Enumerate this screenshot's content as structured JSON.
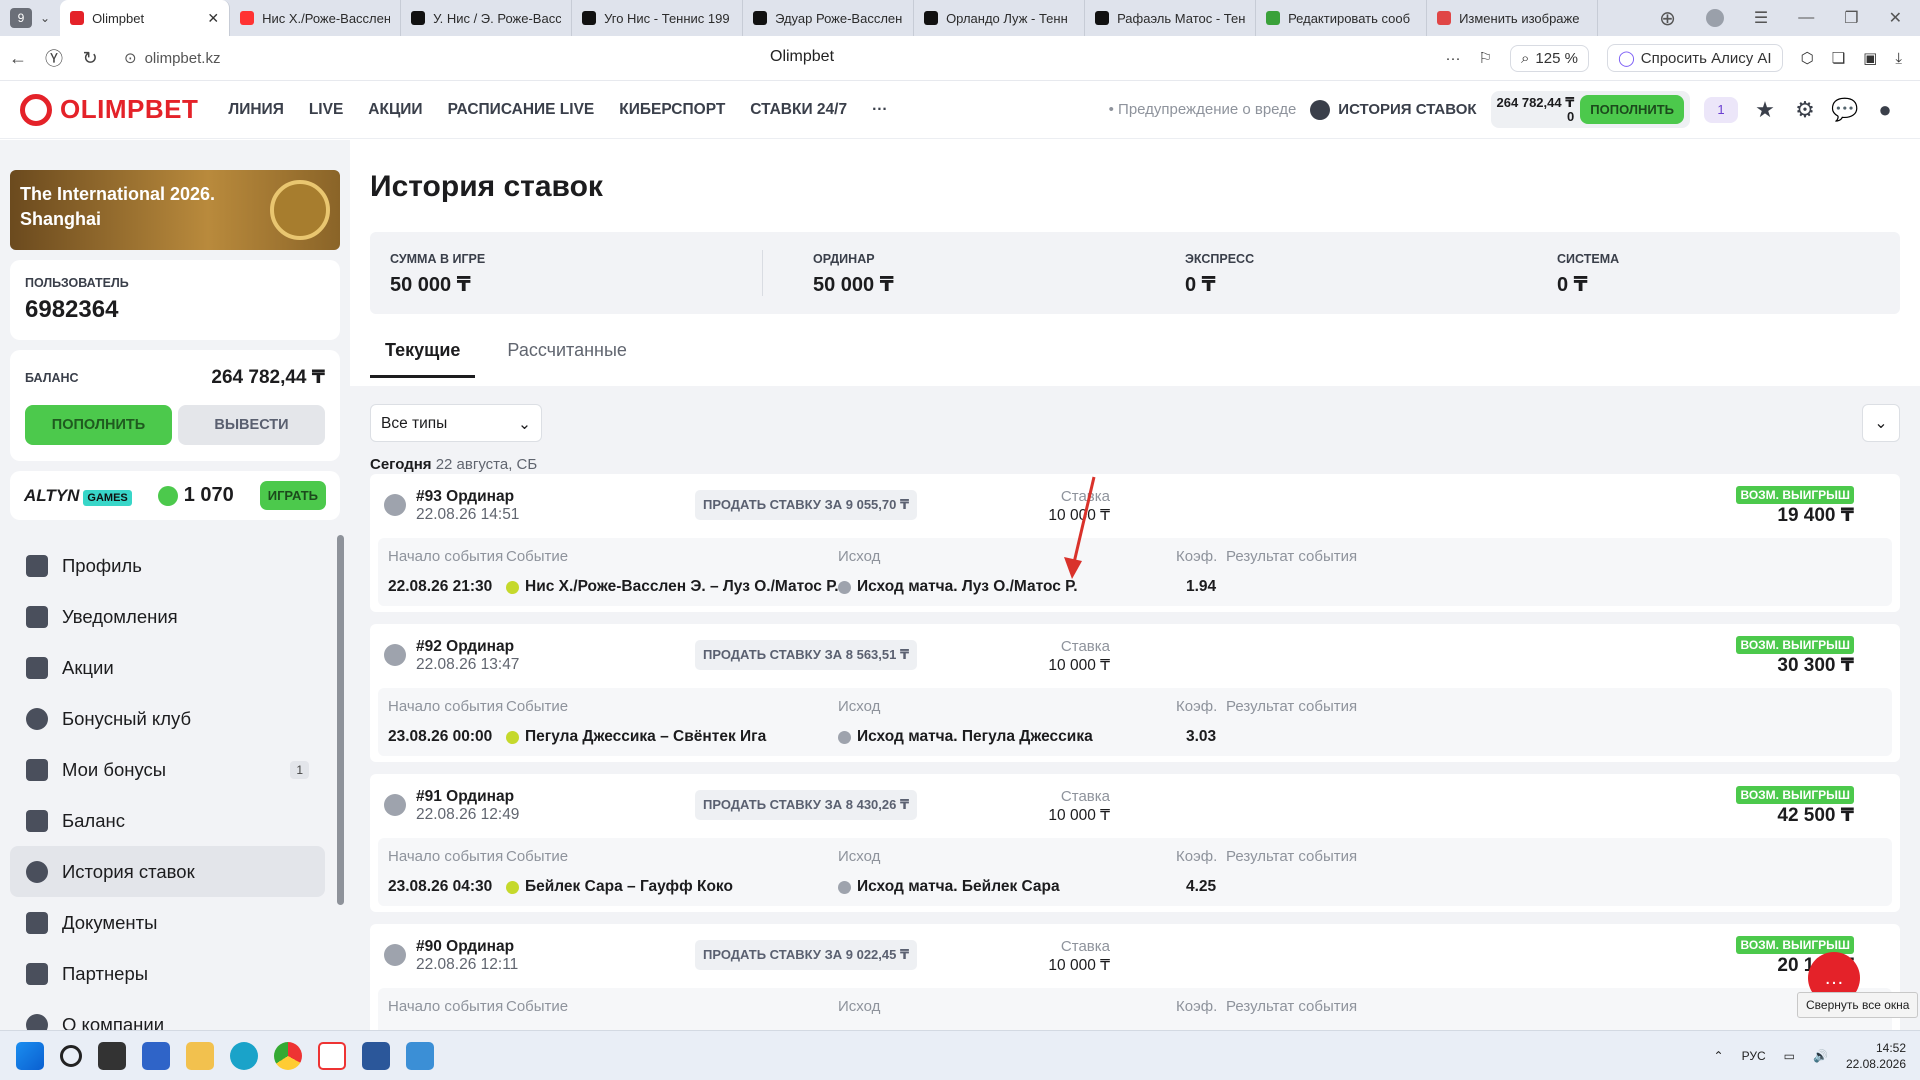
{
  "browser": {
    "tab_count": "9",
    "tabs": [
      {
        "title": "Olimpbet",
        "active": true,
        "icon": "olimpbet-icon",
        "color": "#e42229"
      },
      {
        "title": "Нис Х./Роже-Васслен",
        "icon": "yandex-icon",
        "color": "#f33"
      },
      {
        "title": "У. Нис / Э. Роже-Васс",
        "icon": "flashscore-icon",
        "color": "#111"
      },
      {
        "title": "Уго Нис - Теннис 199",
        "icon": "flashscore-icon",
        "color": "#111"
      },
      {
        "title": "Эдуар Роже-Васслен",
        "icon": "flashscore-icon",
        "color": "#111"
      },
      {
        "title": "Орландо Луж - Тенн",
        "icon": "flashscore-icon",
        "color": "#111"
      },
      {
        "title": "Рафаэль Матос - Тен",
        "icon": "flashscore-icon",
        "color": "#111"
      },
      {
        "title": "Редактировать сооб",
        "icon": "edit-icon",
        "color": "#3aa13a"
      },
      {
        "title": "Изменить изображе",
        "icon": "image-edit-icon",
        "color": "#e04646"
      }
    ],
    "url": "olimpbet.kz",
    "page_title": "Olimpbet",
    "zoom": "125 %",
    "alice": "Спросить Алису AI"
  },
  "header": {
    "logo": "OLIMPBET",
    "menu": [
      "ЛИНИЯ",
      "LIVE",
      "АКЦИИ",
      "РАСПИСАНИЕ LIVE",
      "КИБЕРСПОРТ",
      "СТАВКИ 24/7"
    ],
    "more": "···",
    "warning": "Предупреждение о вреде",
    "history": "ИСТОРИЯ СТАВОК",
    "balance": "264 782,44 ₸",
    "bonus": "0",
    "deposit": "ПОПОЛНИТЬ",
    "notif_count": "1"
  },
  "sidebar": {
    "promo": "The International 2026. Shanghai",
    "user_label": "ПОЛЬЗОВАТЕЛЬ",
    "user_id": "6982364",
    "balance_label": "БАЛАНС",
    "balance": "264 782,44 ₸",
    "deposit": "ПОПОЛНИТЬ",
    "withdraw": "ВЫВЕСТИ",
    "games_logo": "ALTYN",
    "games_tag": "GAMES",
    "coins": "1 070",
    "play": "ИГРАТЬ",
    "items": [
      {
        "label": "Профиль",
        "icon": "profile-icon"
      },
      {
        "label": "Уведомления",
        "icon": "notifications-icon"
      },
      {
        "label": "Акции",
        "icon": "gift-icon"
      },
      {
        "label": "Бонусный клуб",
        "icon": "bonus-club-icon"
      },
      {
        "label": "Мои бонусы",
        "icon": "bonus-icon",
        "count": "1"
      },
      {
        "label": "Баланс",
        "icon": "wallet-icon"
      },
      {
        "label": "История ставок",
        "icon": "history-icon",
        "selected": true
      },
      {
        "label": "Документы",
        "icon": "documents-icon"
      },
      {
        "label": "Партнеры",
        "icon": "handshake-icon"
      },
      {
        "label": "О компании",
        "icon": "info-icon"
      }
    ]
  },
  "main": {
    "title": "История ставок",
    "summary": [
      {
        "label": "СУММА В ИГРЕ",
        "value": "50 000 ₸"
      },
      {
        "label": "ОРДИНАР",
        "value": "50 000 ₸"
      },
      {
        "label": "ЭКСПРЕСС",
        "value": "0 ₸"
      },
      {
        "label": "СИСТЕМА",
        "value": "0 ₸"
      }
    ],
    "tabs": [
      "Текущие",
      "Рассчитанные"
    ],
    "filter": "Все типы",
    "day_bold": "Сегодня",
    "day_rest": "22 августа, СБ",
    "col_start": "Начало события",
    "col_event": "Событие",
    "col_outcome": "Исход",
    "col_coef": "Коэф.",
    "col_result": "Результат события",
    "stake_label": "Ставка",
    "win_label": "ВОЗМ. ВЫИГРЫШ",
    "bets": [
      {
        "num": "#93 Ординар",
        "date": "22.08.26 14:51",
        "sell": "ПРОДАТЬ СТАВКУ ЗА 9 055,70 ₸",
        "stake": "10 000 ₸",
        "win": "19 400 ₸",
        "start": "22.08.26 21:30",
        "event": "Нис Х./Роже-Васслен Э. – Луз О./Матос Р.",
        "outcome": "Исход матча. Луз О./Матос Р.",
        "coef": "1.94"
      },
      {
        "num": "#92 Ординар",
        "date": "22.08.26 13:47",
        "sell": "ПРОДАТЬ СТАВКУ ЗА 8 563,51 ₸",
        "stake": "10 000 ₸",
        "win": "30 300 ₸",
        "start": "23.08.26 00:00",
        "event": "Пегула Джессика – Свёнтек Ига",
        "outcome": "Исход матча. Пегула Джессика",
        "coef": "3.03"
      },
      {
        "num": "#91 Ординар",
        "date": "22.08.26 12:49",
        "sell": "ПРОДАТЬ СТАВКУ ЗА 8 430,26 ₸",
        "stake": "10 000 ₸",
        "win": "42 500 ₸",
        "start": "23.08.26 04:30",
        "event": "Бейлек Сара – Гауфф Коко",
        "outcome": "Исход матча. Бейлек Сара",
        "coef": "4.25"
      },
      {
        "num": "#90 Ординар",
        "date": "22.08.26 12:11",
        "sell": "ПРОДАТЬ СТАВКУ ЗА 9 022,45 ₸",
        "stake": "10 000 ₸",
        "win": "20 100 ₸",
        "start": "",
        "event": "",
        "outcome": "",
        "coef": ""
      }
    ]
  },
  "tooltip": "Свернуть все окна",
  "taskbar": {
    "lang": "РУС",
    "time": "14:52",
    "date": "22.08.2026"
  }
}
